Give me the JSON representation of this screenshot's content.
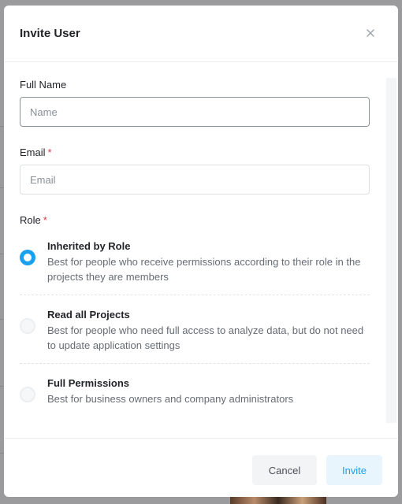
{
  "modal": {
    "title": "Invite User",
    "close_icon": "close-icon"
  },
  "form": {
    "full_name": {
      "label": "Full Name",
      "placeholder": "Name",
      "value": ""
    },
    "email": {
      "label": "Email",
      "required_mark": "*",
      "placeholder": "Email",
      "value": ""
    },
    "role": {
      "label": "Role",
      "required_mark": "*",
      "selected": "inherited",
      "options": [
        {
          "id": "inherited",
          "title": "Inherited by Role",
          "description": "Best for people who receive permissions according to their role in the projects they are members",
          "checked": true
        },
        {
          "id": "read_all",
          "title": "Read all Projects",
          "description": "Best for people who need full access to analyze data, but do not need to update application settings",
          "checked": false
        },
        {
          "id": "full",
          "title": "Full Permissions",
          "description": "Best for business owners and company administrators",
          "checked": false
        }
      ]
    }
  },
  "footer": {
    "cancel_label": "Cancel",
    "invite_label": "Invite"
  },
  "colors": {
    "accent": "#1aa0f0",
    "required": "#e0344c",
    "overlay": "#9a9a9c"
  }
}
